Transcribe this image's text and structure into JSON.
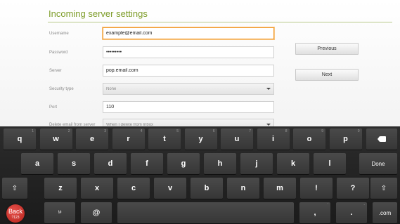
{
  "form": {
    "title": "Incoming server settings",
    "rows": [
      {
        "label": "Username",
        "value": "example@email.com",
        "type": "text",
        "focused": true
      },
      {
        "label": "Password",
        "value": "•••••••••",
        "type": "text",
        "focused": false
      },
      {
        "label": "Server",
        "value": "pop.email.com",
        "type": "text",
        "focused": false
      },
      {
        "label": "Security type",
        "value": "None",
        "type": "select",
        "focused": false
      },
      {
        "label": "Port",
        "value": "110",
        "type": "text",
        "focused": false
      },
      {
        "label": "Delete email from server",
        "value": "When I delete from Inbox",
        "type": "select",
        "focused": false
      }
    ],
    "previous_label": "Previous",
    "next_label": "Next"
  },
  "keyboard": {
    "row1": [
      {
        "label": "q",
        "hint": "1"
      },
      {
        "label": "w",
        "hint": "2"
      },
      {
        "label": "e",
        "hint": "3"
      },
      {
        "label": "r",
        "hint": "4"
      },
      {
        "label": "t",
        "hint": "5"
      },
      {
        "label": "y",
        "hint": "6"
      },
      {
        "label": "u",
        "hint": "7"
      },
      {
        "label": "i",
        "hint": "8"
      },
      {
        "label": "o",
        "hint": "9"
      },
      {
        "label": "p",
        "hint": "0"
      }
    ],
    "row2": [
      "a",
      "s",
      "d",
      "f",
      "g",
      "h",
      "j",
      "k",
      "l"
    ],
    "row3": [
      "z",
      "x",
      "c",
      "v",
      "b",
      "n",
      "m",
      "!",
      "?"
    ],
    "row3_hints": [
      "",
      "",
      "",
      "",
      "",
      "",
      "",
      "",
      ""
    ],
    "done_label": "Done",
    "backspace_icon": "backspace-icon",
    "shift_icon": "shift-icon",
    "shift_glyph": "⇧",
    "symbols_label": "!#",
    "at_label": "@",
    "comma_label": ",",
    "comma_hint": "'",
    "period_label": ".",
    "period_hint": "-",
    "dotcom_label": ".com"
  },
  "back_button": {
    "label": "Back",
    "sub": "?123"
  },
  "colors": {
    "accent": "#7e9d2a",
    "focus": "#f29a2e",
    "back": "#d13a33"
  }
}
